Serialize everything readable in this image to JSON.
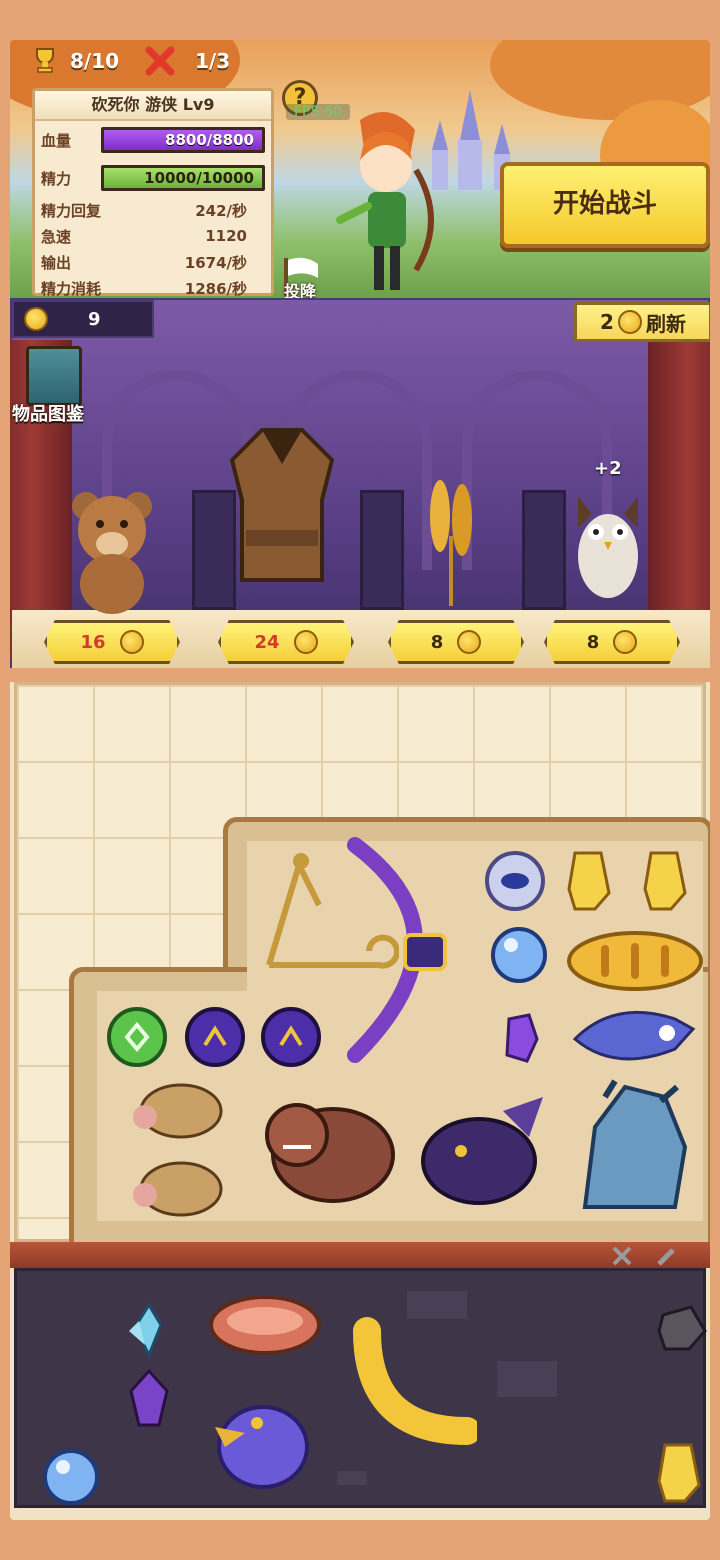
{
  "hud": {
    "trophy_count": "8/10",
    "loss_count": "1/3"
  },
  "stats": {
    "title": "砍死你 游侠 Lv9",
    "hp_label": "血量",
    "hp_value": "8800/8800",
    "energy_label": "精力",
    "energy_value": "10000/10000",
    "rows": [
      {
        "label": "精力回复",
        "value": "242/秒"
      },
      {
        "label": "急速",
        "value": "1120"
      },
      {
        "label": "输出",
        "value": "1674/秒"
      },
      {
        "label": "精力消耗",
        "value": "1286/秒"
      }
    ]
  },
  "scene": {
    "help_symbol": "?",
    "fps": "FPS:60",
    "surrender_label": "投降",
    "start_label": "开始战斗"
  },
  "shop": {
    "gold": "9",
    "refresh_cost": "2",
    "refresh_label": "刷新",
    "codex_label": "物品图鉴",
    "bonus": "+2",
    "items": [
      {
        "name": "bear",
        "price": "16"
      },
      {
        "name": "leather-armor",
        "price": "24"
      },
      {
        "name": "wheat",
        "price": "8"
      },
      {
        "name": "owl",
        "price": "8"
      }
    ]
  },
  "colors": {
    "accent": "#f5cf3a",
    "hp": "#9a45dc",
    "energy": "#8acb4e",
    "background": "#e4a476"
  },
  "backpack": {
    "items": [
      "crossbow",
      "purple-bow",
      "eye-gem",
      "yellow-crystal",
      "yellow-crystal",
      "blue-orb",
      "bread",
      "green-rune",
      "purple-rune",
      "purple-rune",
      "purple-shard",
      "blue-owl",
      "boar",
      "boar",
      "brown-bear",
      "shadow-dragon",
      "ice-dragon"
    ]
  },
  "storage": {
    "items": [
      "blue-crystal",
      "steak",
      "banana",
      "rock",
      "purple-crystal",
      "blue-bird",
      "blue-orb",
      "yellow-crystal"
    ]
  }
}
